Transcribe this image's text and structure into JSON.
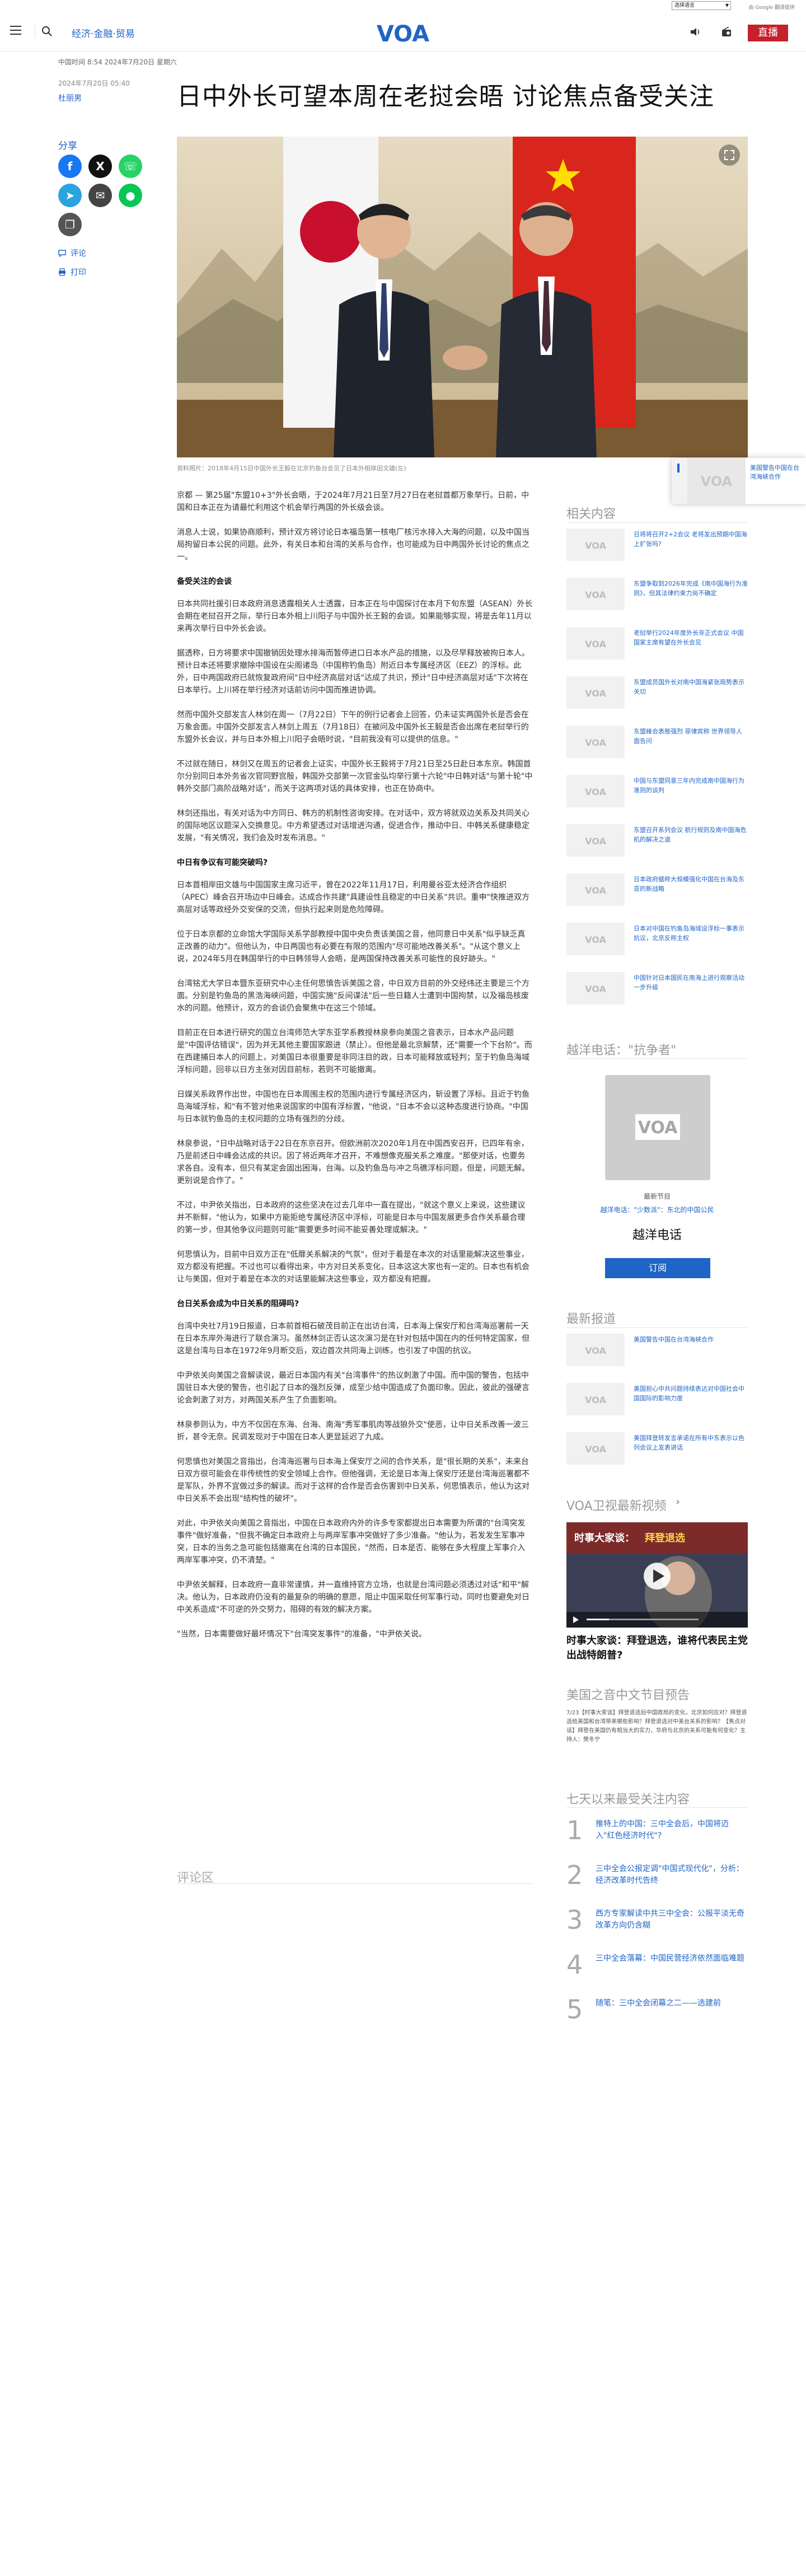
{
  "topbar": {
    "language_select": "选择语言",
    "powered_by": "由 Google 翻译提供"
  },
  "header": {
    "section": "经济·金融·贸易",
    "logo": "VOA",
    "live_label": "直播"
  },
  "article": {
    "kicker": "中国时间 8:54 2024年7月20日 星期六",
    "pubdate": "2024年7月20日 05:40",
    "author": "杜丽男",
    "title": "日中外长可望本周在老挝会晤 讨论焦点备受关注",
    "caption": "资料照片：2018年4月15日中国外长王毅在北京钓鱼台会见了日本外相岸田文雄(左)",
    "body": [
      {
        "t": "p",
        "text": "京都 — 第25届\"东盟10+3\"外长会晤，于2024年7月21日至7月27日在老挝首都万象举行。日前，中国和日本正在为请最忙利用这个机会举行两国的外长级会谈。"
      },
      {
        "t": "p",
        "text": "消息人士说，如果协商顺利，预计双方将讨论日本福岛第一核电厂核污水排入大海的问题，以及中国当局拘留日本公民的问题。此外，有关日本和台湾的关系与合作，也可能成为日中两国外长讨论的焦点之一。"
      },
      {
        "t": "h",
        "text": "备受关注的会谈"
      },
      {
        "t": "p",
        "text": "日本共同社援引日本政府消息透露相关人士透露，日本正在与中国探讨在本月下旬东盟（ASEAN）外长会期在老挝召开之际，举行日本外相上川阳子与中国外长王毅的会谈。如果能够实现，将是去年11月以来再次举行日中外长会谈。"
      },
      {
        "t": "p",
        "text": "据透称，日方将要求中国撤销因处理水排海而暂停进口日本水产品的措施，以及尽早释放被拘日本人。预计日本还将要求撤除中国设在尖阁诸岛（中国称钓鱼岛）附近日本专属经济区（EEZ）的浮标。此外，日中两国政府已就恢复政府间\"日中经济高层对话\"达成了共识，预计\"日中经济高层对话\"下次将在日本举行。上川将在举行经济对话前访问中国而推进协调。"
      },
      {
        "t": "p",
        "text": "然而中国外交部发言人林剑在周一（7月22日）下午的例行记者会上回答，仍未证实两国外长是否会在万象会面。中国外交部发言人林剑上周五（7月18日）在被问及中国外长王毅是否会出席在老挝举行的东盟外长会议，并与日本外相上川阳子会晤时说，\"目前我没有可以提供的信息。\""
      },
      {
        "t": "p",
        "text": "不过就在随日，林剑又在周五的记者会上证实，中国外长王毅将于7月21日至25日赴日本东京。韩国首尔分别同日本外务省次官同野宫殷，韩国外交部第一次官金弘均举行第十六轮\"中日韩对话\"与第十轮\"中韩外交部门高阶战略对话\"，而关于这两项对话的具体安排，也正在协商中。"
      },
      {
        "t": "p",
        "text": "林剑还指出，有关对话为中方同日、韩方的机制性咨询安排。在对话中，双方将就双边关系及共同关心的国际地区议题深入交换意见。中方希望透过对话增进沟通，促进合作，推动中日、中韩关系健康稳定发展，\"有关情况，我们会及时发布消息。\""
      },
      {
        "t": "h",
        "text": "中日有争议有可能突破吗?"
      },
      {
        "t": "p",
        "text": "日本首相岸田文雄与中国国家主席习近平，曾在2022年11月17日，利用曼谷亚太经济合作组织（APEC）峰会召开场边中日峰会。达成合作共建\"具建设性且稳定的中日关系\"共识。重申\"快推进双方高层对话等政经外交安保的交流，但执行起来则是危险障碍。"
      },
      {
        "t": "p",
        "text": "位于日本京都的立命馆大学国际关系学部教授中国中央负责该美国之音，他同意日中关系\"似乎缺乏真正改善的动力\"。但他认为，中日两国也有必要在有限的范围内\"尽可能地改善关系\"。\"从这个意义上说，2024年5月在韩国举行的中日韩领导人会晤，是两国保持改善关系可能性的良好跡头。\""
      },
      {
        "t": "p",
        "text": "台湾铭尤大学日本暨东亚研究中心主任何思慎告诉美国之音，中日双方目前的外交经纬还主要是三个方面。分别是钓鱼岛的黑浩海峡问题，中国实施\"反间谍法\"后一些日籍人士遭到中国拘禁，以及福岛核废水的问题。他预计，双方的会谈仍会聚焦中在这三个领域。"
      },
      {
        "t": "p",
        "text": "目前正在日本进行研究的国立台湾师范大学东亚学系教授林泉参向美国之音表示，日本水产品问题是\"中国评估错误\"，因为并无其他主要国家跟进（禁止）。但他是最北京解禁，还\"需要一个下台阶\"。而在西建捕日本人的问题上，对美国日本很重要是非同注目的政，日本可能释放或轻判；至于钓鱼岛海域浮标问题，回非以日方主张对因目前标，若则不可能撤离。"
      },
      {
        "t": "p",
        "text": "日媒关系政界作出世，中国也在日本周围主权的范围内进行专属经济区内，斩设置了浮标。且近于钓鱼岛海域浮标，和\"有不管对他来说国家的中国有浮标置，\"他说，\"日本不会以这种态度进行协商。\"中国与日本就钓鱼岛的主权问题的立场有强烈的分歧。"
      },
      {
        "t": "p",
        "text": "林泉参说，\"日中战略对话于22日在东京召开。但欧洲前次2020年1月在中国西安召开，已四年有余，乃是前述日中峰会达成的共识。因了将近两年才召开，不难想像克服关系之难度。\"那使对话，也要务求各自。没有本，但只有某定会固出困海，台海。以及钓鱼岛与冲之鸟礁浮标问题，但是，问题无解。更别说是合作了。\""
      },
      {
        "t": "p",
        "text": "不过，中尹依关指出，日本政府的这些坚决在过去几年中一直在提出，\"就这个意义上来说，这些建议并不新鲜，\"他认为，如果中方能拒绝专属经济区中浮标，可能是日本与中国发展更多合作关系最合理的第一步，但其他争议问题则可能\"需要更多时间不能妥善处理或解决。\""
      },
      {
        "t": "p",
        "text": "何思慎认为，目前中日双方正在\"低靡关系解决的气氛\"，但对于着是在本次的对话里能解决这些事业，双方都没有把握。不过也可以看得出来，中方对日关系变化，日本这这大家也有一定的。日本也有机会让与美国，但对于着是在本次的对话里能解决这些事业，双方都没有把握。"
      },
      {
        "t": "h",
        "text": "台日关系会成为中日关系的阻碍吗?"
      },
      {
        "t": "p",
        "text": "台湾中央社7月19日报道，日本前首相石破茂目前正在出访台湾，日本海上保安厅和台湾海巡署前一天在日本东岸外海进行了联合演习。虽然林剑正否认这次演习是在针对包括中国在内的任何特定国家，但这是台湾与日本在1972年9月断交后，双边首次共同海上训练，也引发了中国的抗议。"
      },
      {
        "t": "p",
        "text": "中尹依关向美国之音解读说，最近日本国内有关\"台湾事件\"的热议刺激了中国。而中国的警告，包括中国驻日本大使的警告，也引起了日本的强烈反弹，成至少给中国造成了负面印象。因此，彼此的强硬言论会刺激了对方，对两国关系产生了负面影响。"
      },
      {
        "t": "p",
        "text": "林泉参则认为，中方不仅因在东海、台海、南海\"秀军事肌肉等战狼外交\"使恶，让中日关系改善一波三折，甚令无奈。民调发现对于中国在日本人更显延迟了九成。"
      },
      {
        "t": "p",
        "text": "何思慎也对美国之音指出，台湾海巡署与日本海上保安厅之间的合作关系，是\"很长期的关系\"，未来台日双方很可能会在非传统性的安全领域上合作。但他强调，无论是日本海上保安厅还是台湾海巡署都不是军队，外界不宜做过多的解读。而对于这样的合作是否会伤害到中日关系，何思慎表示，他认为这对中日关系不会出现\"结构性的破坏\"。"
      },
      {
        "t": "p",
        "text": "对此，中尹依关向美国之音指出，中国在日本政府内外的许多专家都提出日本需要为所谓的\"台湾突发事件\"做好准备，\"但我不确定日本政府上与两岸军事冲突做好了多少准备。\"他认为，若发发生军事冲突，日本的当务之急可能包括撤离在台湾的日本国民，\"然而，日本是否、能够在多大程度上军事介入两岸军事冲突，仍不清楚。\""
      },
      {
        "t": "p",
        "text": "中尹依关解释，日本政府一直非常谨慎，并一直维持官方立场，也就是台湾问题必须透过对话\"和平\"解决。他认为，日本政府仍没有的最复杂的明确的意愿，阻止中国采取任何军事行动，同时也要避免对日中关系造成\"不可逆的外交努力，阻碍的有效的解决方案。"
      },
      {
        "t": "p",
        "text": "\"当然，日本需要做好最坏情况下\"台湾突发事件\"的准备，\"中尹依关说。"
      }
    ]
  },
  "share": {
    "label": "分享",
    "comments_link": "评论",
    "print_link": "打印"
  },
  "comments": {
    "heading": "评论区"
  },
  "floating_next": {
    "text": "美国警告中国在台湾海峡合作"
  },
  "sidebar": {
    "related_heading": "相关内容",
    "related": [
      "日将将召开2+2会议 老将发出预期中国海上扩张吗?",
      "东盟争取到2026年完成《南中国海行为准则》，但其法律约束力尚不确定",
      "老挝举行2024年度外长非正式会议 中国国家主席有望在外长会见",
      "东盟成员国外长对南中国海紧张局势表示关切",
      "东盟峰会表態强烈 菲律宾称 世界领导人面告问",
      "中国与东盟同意三年内完成南中国海行为准则的谈判",
      "东盟召开系列会议 航行规则及南中国海危机的解决之道",
      "日本政府据称大规模强化中国在台海及东亚的新战略",
      "日本对中国在钓鱼岛海域设浮标一事表示抗议，北京反称主权",
      "中国针对日本国民在南海上进行观察活动一步升级"
    ],
    "podcast_heading": "越洋电话：\"抗争者\"",
    "podcast_latest": "最新节目",
    "podcast_episode": "越洋电话：\"少数派\"：东北的中国公民",
    "podcast_title": "越洋电话",
    "subscribe_label": "订阅",
    "latest_heading": "最新报道",
    "latest": [
      "美国警告中国在台湾海峡合作",
      "美国担心中共问题持续表达对中国社会中国国际的影响力度",
      "美国拜登转发言承诺在所有中东表示以色列会议上发表讲话"
    ],
    "video_heading": "VOA卫视最新视频",
    "video_title": "时事大家谈：拜登退选，谁将代表民主党出战特朗普?",
    "video_overlay_a": "时事大家谈：",
    "video_overlay_b": "拜登退选",
    "program_heading": "美国之音中文节目预告",
    "program_text": "7/23【时事大家谈】拜登退选后中国政局的变化，北京如何应对？拜登退选给美国和台湾带来哪些影响？拜登退选对中美台关系的影响？【焦点对话】拜登在美国仍有相当大的实力，华府与北京的关系可能有何变化？主持人：樊冬宁",
    "ranking_heading": "七天以来最受关注内容",
    "ranking": [
      {
        "num": "1",
        "text": "推特上的中国：三中全会后，中国将迈入\"红色经济时代\"?"
      },
      {
        "num": "2",
        "text": "三中全会公报定调\"中国式现代化\"，分析：经济改革时代告终"
      },
      {
        "num": "3",
        "text": "西方专家解读中共三中全会：公报平淡无奇 改革方向仍含糊"
      },
      {
        "num": "4",
        "text": "三中全会落幕：中国民营经济依然面临难题"
      },
      {
        "num": "5",
        "text": "随笔：三中全会闭幕之二——选建前"
      }
    ]
  }
}
